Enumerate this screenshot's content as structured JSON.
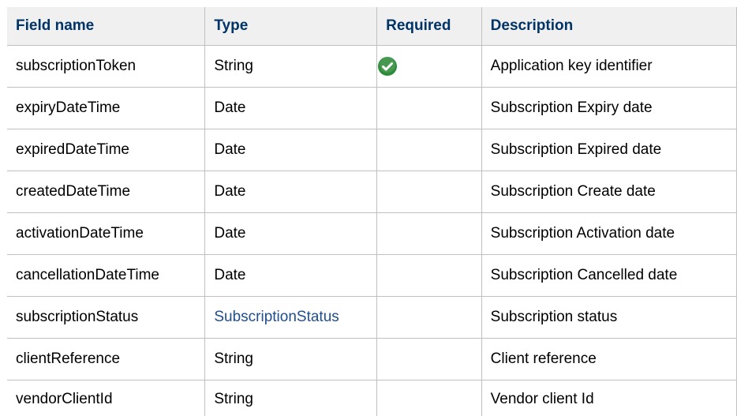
{
  "table": {
    "headers": [
      "Field name",
      "Type",
      "Required",
      "Description"
    ],
    "rows": [
      {
        "field": "subscriptionToken",
        "type": "String",
        "type_is_link": false,
        "required": true,
        "description": "Application key identifier"
      },
      {
        "field": "expiryDateTime",
        "type": "Date",
        "type_is_link": false,
        "required": false,
        "description": "Subscription Expiry date"
      },
      {
        "field": "expiredDateTime",
        "type": "Date",
        "type_is_link": false,
        "required": false,
        "description": "Subscription Expired date"
      },
      {
        "field": "createdDateTime",
        "type": "Date",
        "type_is_link": false,
        "required": false,
        "description": "Subscription Create date"
      },
      {
        "field": "activationDateTime",
        "type": "Date",
        "type_is_link": false,
        "required": false,
        "description": "Subscription Activation date"
      },
      {
        "field": "cancellationDateTime",
        "type": "Date",
        "type_is_link": false,
        "required": false,
        "description": "Subscription Cancelled date"
      },
      {
        "field": "subscriptionStatus",
        "type": "SubscriptionStatus",
        "type_is_link": true,
        "required": false,
        "description": "Subscription status"
      },
      {
        "field": "clientReference",
        "type": "String",
        "type_is_link": false,
        "required": false,
        "description": "Client reference"
      },
      {
        "field": "vendorClientId",
        "type": "String",
        "type_is_link": false,
        "required": false,
        "description": "Vendor client Id"
      }
    ]
  },
  "icons": {
    "required_check": "check-circle-icon"
  },
  "colors": {
    "header_text": "#003366",
    "header_bg": "#f0f0f0",
    "link": "#1f4e8c",
    "check_green": "#2e8b3a",
    "border": "#c0c0c0"
  }
}
